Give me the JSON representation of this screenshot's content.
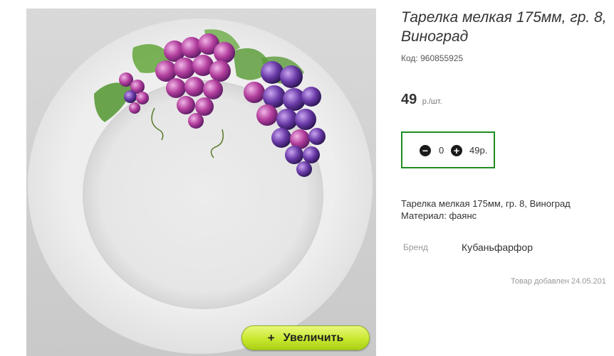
{
  "product": {
    "title": "Тарелка мелкая 175мм, гр. 8, Виноград",
    "code_label": "Код:",
    "code_value": "960855925",
    "price": "49",
    "price_unit": "р./шт.",
    "image_alt": "Тарелка мелкая с рисунком винограда",
    "zoom_icon": "+",
    "zoom_label": "Увеличить",
    "description_line1": "Тарелка мелкая 175мм, гр. 8, Виноград",
    "description_line2": "Материал: фаянс",
    "brand_label": "Бренд",
    "brand_value": "Кубаньфарфор",
    "added_text": "Товар добавлен 24.05.201"
  },
  "cart": {
    "minus_icon": "−",
    "plus_icon": "+",
    "quantity": "0",
    "sum": "49р."
  },
  "colors": {
    "accent_border": "#1f8c1f",
    "zoom_button": "#c9e82f"
  }
}
